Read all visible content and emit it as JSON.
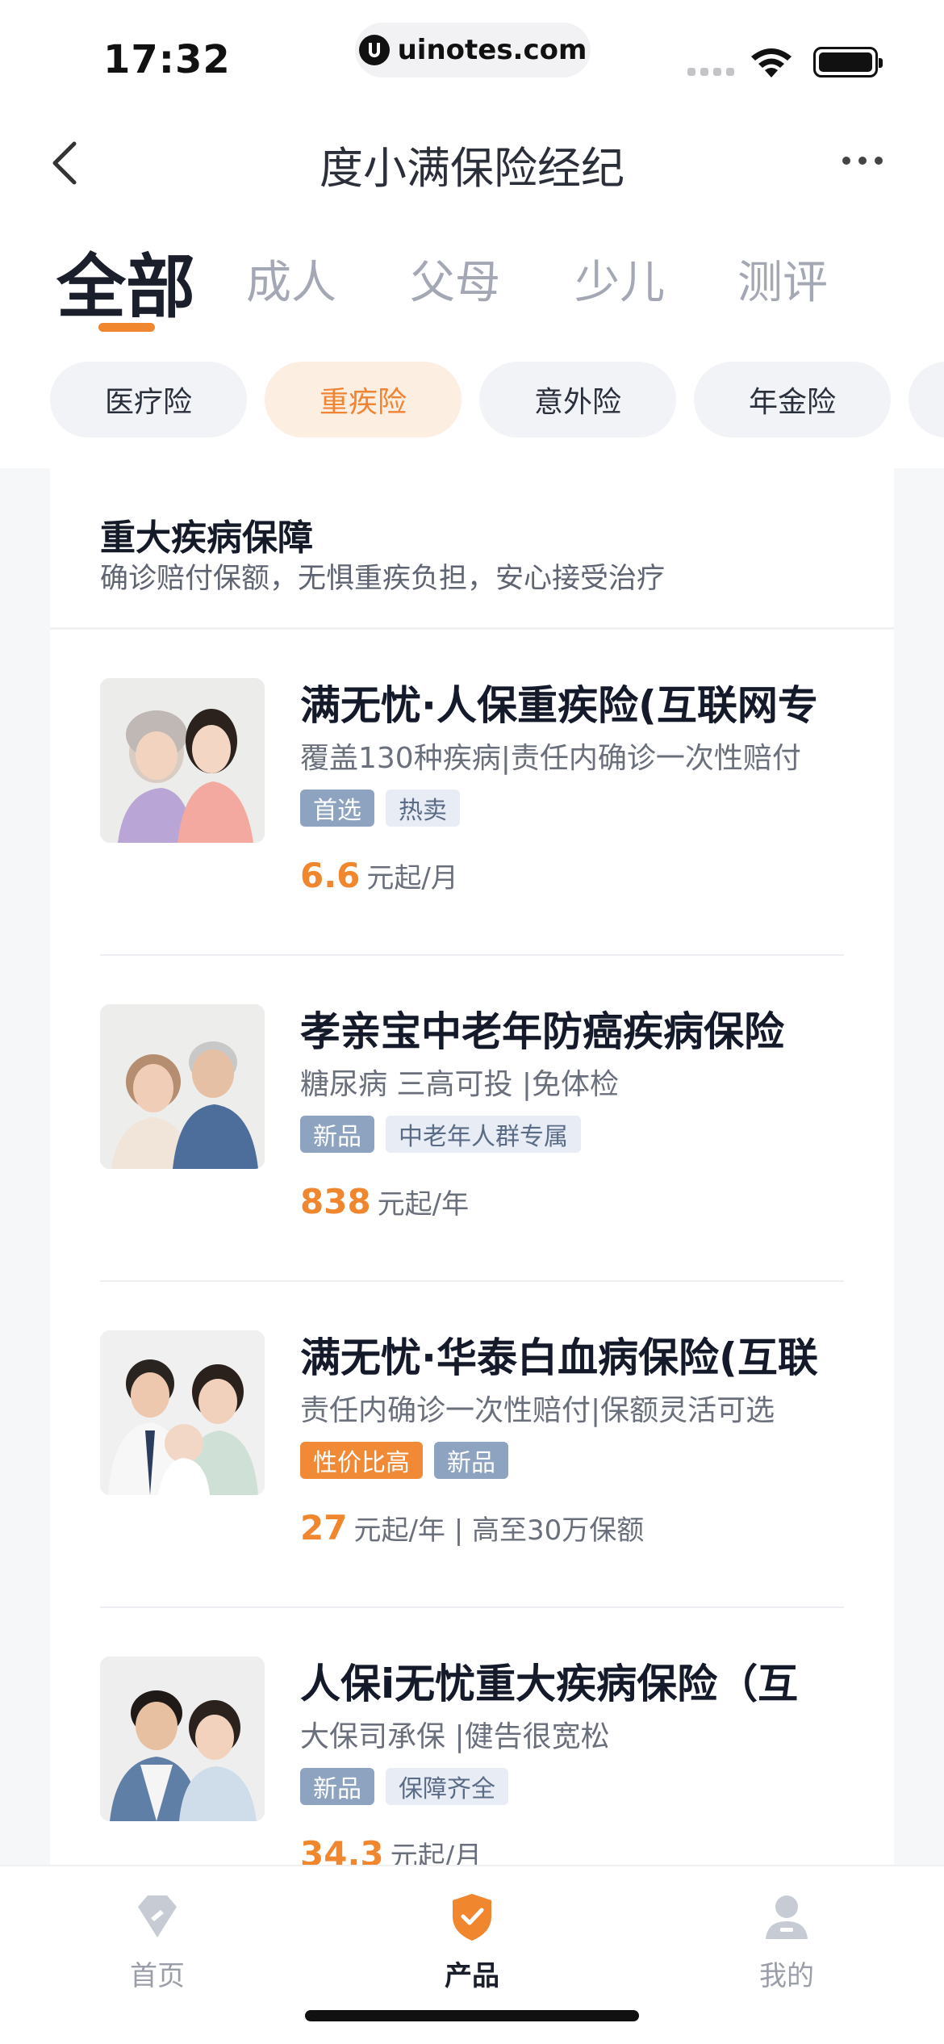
{
  "status_bar": {
    "time": "17:32",
    "url": "uinotes.com"
  },
  "nav": {
    "title": "度小满保险经纪"
  },
  "category_tabs": [
    {
      "label": "全部",
      "active": true
    },
    {
      "label": "成人",
      "active": false
    },
    {
      "label": "父母",
      "active": false
    },
    {
      "label": "少儿",
      "active": false
    },
    {
      "label": "测评",
      "active": false
    }
  ],
  "filter_chips": [
    {
      "label": "医疗险",
      "active": false
    },
    {
      "label": "重疾险",
      "active": true
    },
    {
      "label": "意外险",
      "active": false
    },
    {
      "label": "年金险",
      "active": false
    }
  ],
  "section": {
    "title": "重大疾病保障",
    "desc": "确诊赔付保额，无惧重疾负担，安心接受治疗"
  },
  "products": [
    {
      "name": "满无忧·人保重疾险(互联网专",
      "desc": "覆盖130种疾病|责任内确诊一次性赔付",
      "tags": [
        {
          "text": "首选",
          "style": "blue"
        },
        {
          "text": "热卖",
          "style": "light"
        }
      ],
      "price": "6.6",
      "price_unit": "元起/月",
      "image": "grandmother-daughter-photo"
    },
    {
      "name": "孝亲宝中老年防癌疾病保险",
      "desc": "糖尿病 三高可投 |免体检",
      "tags": [
        {
          "text": "新品",
          "style": "blue"
        },
        {
          "text": "中老年人群专属",
          "style": "light"
        }
      ],
      "price": "838",
      "price_unit": "元起/年",
      "image": "elderly-couple-photo"
    },
    {
      "name": "满无忧·华泰白血病保险(互联",
      "desc": "责任内确诊一次性赔付|保额灵活可选",
      "tags": [
        {
          "text": "性价比高",
          "style": "orange"
        },
        {
          "text": "新品",
          "style": "blue"
        }
      ],
      "price": "27",
      "price_unit": "元起/年 | 高至30万保额",
      "image": "young-family-photo"
    },
    {
      "name": "人保i无忧重大疾病保险（互",
      "desc": "大保司承保 |健告很宽松",
      "tags": [
        {
          "text": "新品",
          "style": "blue"
        },
        {
          "text": "保障齐全",
          "style": "light"
        }
      ],
      "price": "34.3",
      "price_unit": "元起/月",
      "image": "young-couple-photo"
    }
  ],
  "tabbar": [
    {
      "label": "首页",
      "icon": "home-diamond-icon",
      "active": false
    },
    {
      "label": "产品",
      "icon": "shield-check-icon",
      "active": true
    },
    {
      "label": "我的",
      "icon": "person-icon",
      "active": false
    }
  ],
  "colors": {
    "accent": "#f0862e",
    "tag_blue": "#8ea3bf",
    "text_dark": "#1b1f2c"
  }
}
